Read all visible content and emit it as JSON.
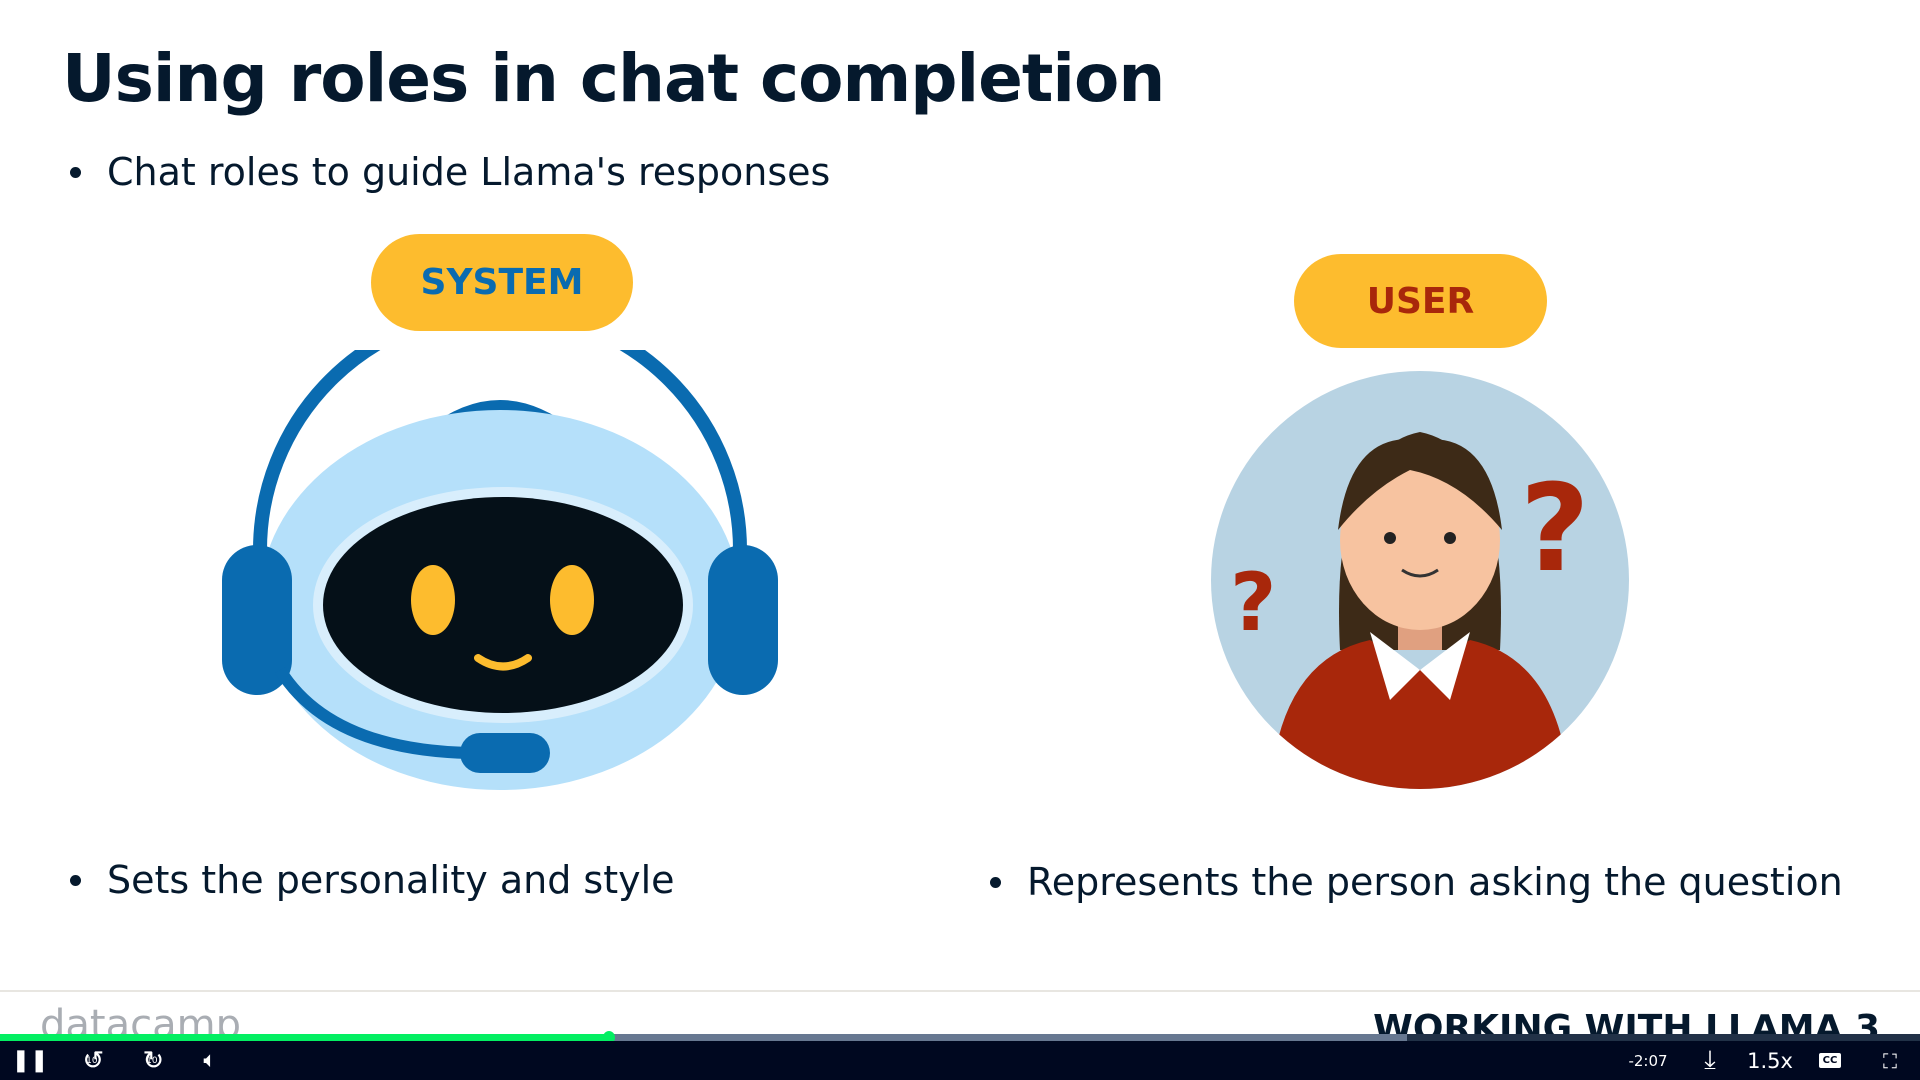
{
  "slide": {
    "title": "Using roles in chat completion",
    "intro_bullet": "Chat roles to guide Llama's responses",
    "system": {
      "label": "SYSTEM",
      "bullet": "Sets the personality and style",
      "label_color": "#0a6bb0"
    },
    "user": {
      "label": "USER",
      "bullet": "Represents the person asking the question",
      "label_color": "#a8270b"
    },
    "footer_logo": "datacamp",
    "course_title": "WORKING WITH LLAMA 3"
  },
  "player": {
    "progress_percent": 31.7,
    "buffered_percent": 73.3,
    "time_remaining": "-2:07",
    "speed": "1.5x",
    "rewind_label": "10",
    "forward_label": "10",
    "cc_label": "CC"
  }
}
